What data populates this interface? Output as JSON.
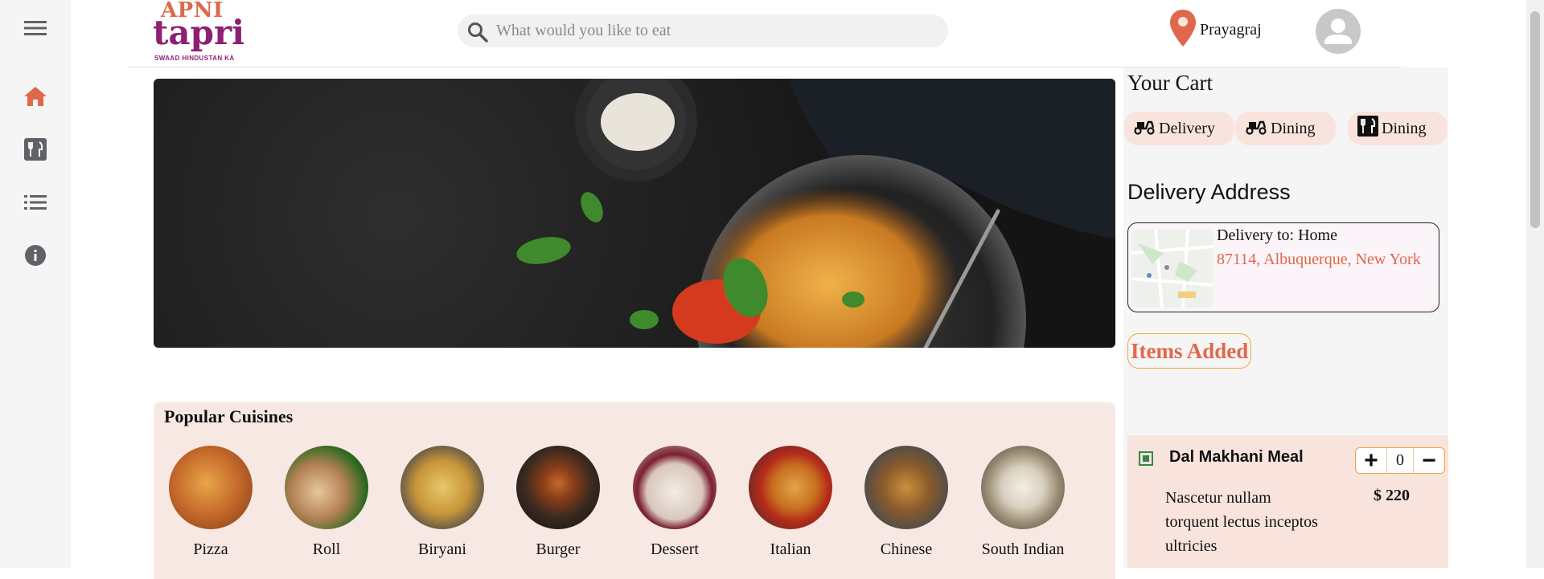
{
  "sidebar": {
    "items": [
      {
        "icon": "hamburger-menu-icon"
      },
      {
        "icon": "home-icon",
        "active": true
      },
      {
        "icon": "restaurant-icon"
      },
      {
        "icon": "list-icon"
      },
      {
        "icon": "info-icon"
      }
    ],
    "active_color": "#e0684a",
    "icon_color": "#5f6368"
  },
  "header": {
    "logo": {
      "line1": "APNI",
      "line2": "tapri",
      "tagline": "SWAAD HINDUSTAN KA"
    },
    "search": {
      "placeholder": "What would you like to eat",
      "value": ""
    },
    "location": "Prayagraj",
    "location_icon": "map-pin-icon"
  },
  "popular": {
    "title": "Popular Cuisines",
    "items": [
      {
        "label": "Pizza"
      },
      {
        "label": "Roll"
      },
      {
        "label": "Biryani"
      },
      {
        "label": "Burger"
      },
      {
        "label": "Dessert"
      },
      {
        "label": "Italian"
      },
      {
        "label": "Chinese"
      },
      {
        "label": "South Indian"
      }
    ]
  },
  "cart": {
    "title": "Your Cart",
    "chips": [
      {
        "label": "Delivery",
        "icon": "scooter-icon"
      },
      {
        "label": "Dining",
        "icon": "scooter-icon"
      },
      {
        "label": "Dining",
        "icon": "fork-knife-icon"
      }
    ],
    "address_title": "Delivery Address",
    "address": {
      "label": "Delivery to: Home",
      "line": "87114, Albuquerque, New York"
    },
    "items_added": "Items Added",
    "items": [
      {
        "name": "Dal Makhani Meal",
        "qty": "0",
        "desc": "Nascetur nullam torquent lectus inceptos ultricies",
        "price": "$ 220",
        "plus": "+",
        "minus": "−"
      }
    ]
  },
  "colors": {
    "accent": "#e0684a",
    "brand": "#8e1f73",
    "panel": "#f8e4dd",
    "outline": "#f1a53b"
  }
}
